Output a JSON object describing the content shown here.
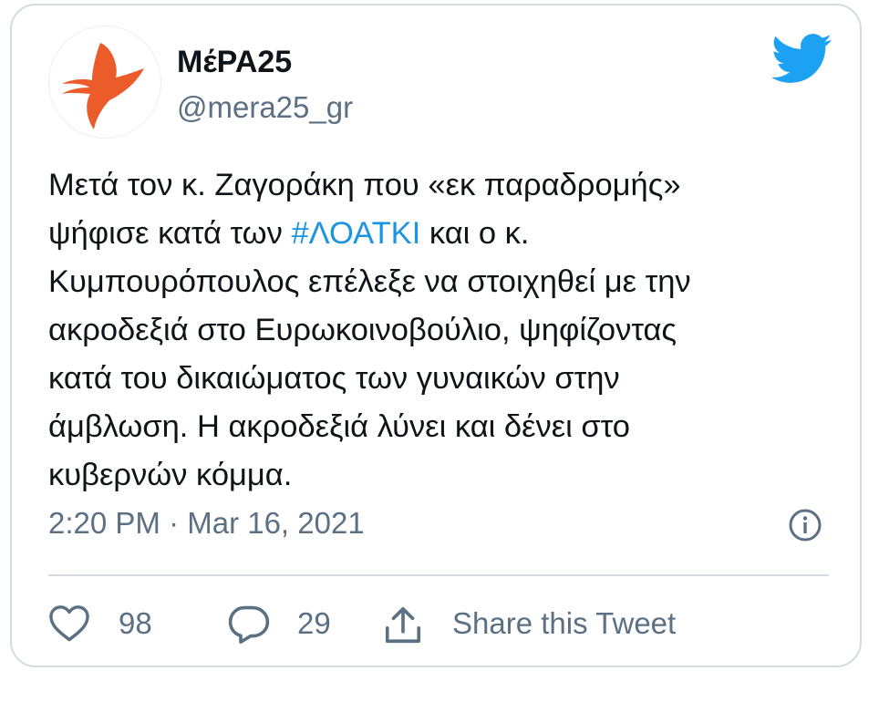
{
  "tweet": {
    "author": {
      "display_name": "ΜέΡΑ25",
      "handle": "@mera25_gr",
      "avatar_icon": "swallow-bird-logo",
      "avatar_color": "#ec5b2a"
    },
    "platform_icon": "twitter-bird-icon",
    "platform_color": "#1da1f2",
    "text_lines": [
      {
        "before": "Μετά τον κ. Ζαγοράκη που «εκ παραδρομής»",
        "hashtag": "",
        "after": ""
      },
      {
        "before": "ψήφισε κατά των ",
        "hashtag": "#ΛΟΑΤΚΙ",
        "after": " και ο κ."
      },
      {
        "before": "Κυμπουρόπουλος επέλεξε να στοιχηθεί με την",
        "hashtag": "",
        "after": ""
      },
      {
        "before": "ακροδεξιά στο Ευρωκοινοβούλιο, ψηφίζοντας",
        "hashtag": "",
        "after": ""
      },
      {
        "before": "κατά του δικαιώματος των γυναικών στην",
        "hashtag": "",
        "after": ""
      },
      {
        "before": "άμβλωση. Η ακροδεξιά λύνει και δένει στο",
        "hashtag": "",
        "after": ""
      },
      {
        "before": "κυβερνών κόμμα.",
        "hashtag": "",
        "after": ""
      }
    ],
    "hashtag_color": "#1b95e0",
    "timestamp": "2:20 PM · Mar 16, 2021",
    "info_icon": "info-icon",
    "actions": {
      "likes": {
        "icon": "heart-icon",
        "count": "98"
      },
      "replies": {
        "icon": "reply-icon",
        "count": "29"
      },
      "share": {
        "icon": "share-icon",
        "label": "Share this Tweet"
      }
    }
  }
}
